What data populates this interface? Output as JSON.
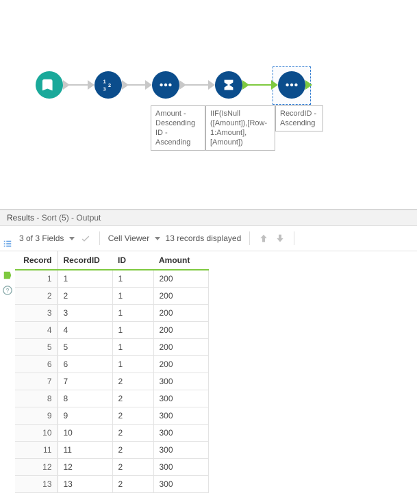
{
  "workflow": {
    "tools": [
      {
        "id": "input",
        "name": "text-input-tool",
        "annot": null
      },
      {
        "id": "recordid",
        "name": "recordid-tool",
        "annot": null
      },
      {
        "id": "sort1",
        "name": "sort-tool",
        "annot": "Amount -\nDescending\nID - Ascending"
      },
      {
        "id": "multirow",
        "name": "multirow-formula-tool",
        "annot": "IIF(IsNull\n([Amount]),[Row-\n1:Amount],\n[Amount])"
      },
      {
        "id": "sort2",
        "name": "sort-tool",
        "annot": "RecordID -\nAscending"
      }
    ]
  },
  "results": {
    "header": {
      "title": "Results",
      "subtitle": "- Sort (5) - Output"
    },
    "toolbar": {
      "fields_label": "3 of 3 Fields",
      "cell_viewer": "Cell Viewer",
      "records_displayed": "13 records displayed"
    },
    "columns": [
      "Record",
      "RecordID",
      "ID",
      "Amount"
    ],
    "rows": [
      {
        "Record": 1,
        "RecordID": "1",
        "ID": "1",
        "Amount": "200"
      },
      {
        "Record": 2,
        "RecordID": "2",
        "ID": "1",
        "Amount": "200"
      },
      {
        "Record": 3,
        "RecordID": "3",
        "ID": "1",
        "Amount": "200"
      },
      {
        "Record": 4,
        "RecordID": "4",
        "ID": "1",
        "Amount": "200"
      },
      {
        "Record": 5,
        "RecordID": "5",
        "ID": "1",
        "Amount": "200"
      },
      {
        "Record": 6,
        "RecordID": "6",
        "ID": "1",
        "Amount": "200"
      },
      {
        "Record": 7,
        "RecordID": "7",
        "ID": "2",
        "Amount": "300"
      },
      {
        "Record": 8,
        "RecordID": "8",
        "ID": "2",
        "Amount": "300"
      },
      {
        "Record": 9,
        "RecordID": "9",
        "ID": "2",
        "Amount": "300"
      },
      {
        "Record": 10,
        "RecordID": "10",
        "ID": "2",
        "Amount": "300"
      },
      {
        "Record": 11,
        "RecordID": "11",
        "ID": "2",
        "Amount": "300"
      },
      {
        "Record": 12,
        "RecordID": "12",
        "ID": "2",
        "Amount": "300"
      },
      {
        "Record": 13,
        "RecordID": "13",
        "ID": "2",
        "Amount": "300"
      }
    ]
  },
  "chart_data": {
    "type": "table",
    "title": "Results - Sort (5) - Output",
    "columns": [
      "Record",
      "RecordID",
      "ID",
      "Amount"
    ],
    "rows": [
      [
        1,
        1,
        1,
        200
      ],
      [
        2,
        2,
        1,
        200
      ],
      [
        3,
        3,
        1,
        200
      ],
      [
        4,
        4,
        1,
        200
      ],
      [
        5,
        5,
        1,
        200
      ],
      [
        6,
        6,
        1,
        200
      ],
      [
        7,
        7,
        2,
        300
      ],
      [
        8,
        8,
        2,
        300
      ],
      [
        9,
        9,
        2,
        300
      ],
      [
        10,
        10,
        2,
        300
      ],
      [
        11,
        11,
        2,
        300
      ],
      [
        12,
        12,
        2,
        300
      ],
      [
        13,
        13,
        2,
        300
      ]
    ]
  }
}
